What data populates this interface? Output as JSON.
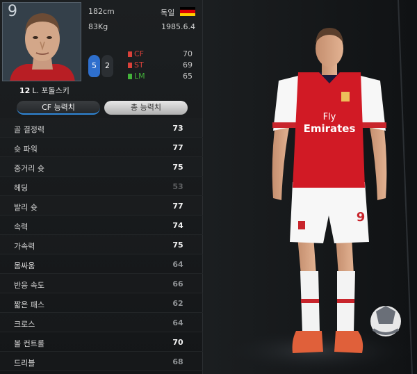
{
  "player": {
    "number": "9",
    "shirt_badge": "12",
    "name": "L. 포돌스키",
    "height": "182cm",
    "weight": "83Kg",
    "nationality": "독일",
    "birthdate": "1985.6.4",
    "foot_left": "5",
    "foot_right": "2"
  },
  "positions": [
    {
      "label": "CF",
      "value": "70",
      "color": "#d9413a"
    },
    {
      "label": "ST",
      "value": "69",
      "color": "#d9413a"
    },
    {
      "label": "LM",
      "value": "65",
      "color": "#43b23a"
    }
  ],
  "tabs": {
    "cf_label": "CF 능력치",
    "total_label": "총 능력치"
  },
  "stats": [
    {
      "name": "골 결정력",
      "value": "73",
      "color": "#f2f2f2"
    },
    {
      "name": "슛 파워",
      "value": "77",
      "color": "#f2f2f2"
    },
    {
      "name": "중거리 슛",
      "value": "75",
      "color": "#f2f2f2"
    },
    {
      "name": "헤딩",
      "value": "53",
      "color": "#5e6062"
    },
    {
      "name": "발리 슛",
      "value": "77",
      "color": "#f2f2f2"
    },
    {
      "name": "속력",
      "value": "74",
      "color": "#f2f2f2"
    },
    {
      "name": "가속력",
      "value": "75",
      "color": "#f2f2f2"
    },
    {
      "name": "몸싸움",
      "value": "64",
      "color": "#8f9295"
    },
    {
      "name": "반응 속도",
      "value": "66",
      "color": "#8f9295"
    },
    {
      "name": "짧은 패스",
      "value": "62",
      "color": "#8f9295"
    },
    {
      "name": "크로스",
      "value": "64",
      "color": "#8f9295"
    },
    {
      "name": "볼 컨트롤",
      "value": "70",
      "color": "#f2f2f2"
    },
    {
      "name": "드리블",
      "value": "68",
      "color": "#8f9295"
    }
  ],
  "render": {
    "sponsor_line1": "Fly",
    "sponsor_line2": "Emirates",
    "shorts_number": "9",
    "shirt_color": "#d11a25",
    "sleeve_color": "#ffffff"
  },
  "colors": {
    "accent_blue": "#2f86d6",
    "flag": [
      "#000000",
      "#dd0000",
      "#ffce00"
    ]
  }
}
